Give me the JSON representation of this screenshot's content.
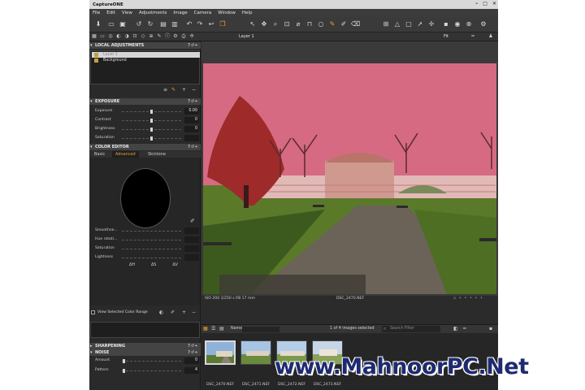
{
  "app": {
    "title": "CaptureONE",
    "window_controls": [
      "–",
      "□",
      "✕"
    ]
  },
  "menu": [
    "File",
    "Edit",
    "View",
    "Adjustments",
    "Image",
    "Camera",
    "Window",
    "Help"
  ],
  "toolbar2": {
    "layer_selector": "Layer 1",
    "fit_label": "Fit"
  },
  "local_adjustments": {
    "header": "LOCAL ADJUSTMENTS",
    "layers": [
      {
        "name": "Layer 1",
        "selected": true
      },
      {
        "name": "Background",
        "selected": false
      }
    ]
  },
  "exposure": {
    "header": "EXPOSURE",
    "sliders": [
      {
        "label": "Exposure",
        "value": "0.00",
        "position": 0.5
      },
      {
        "label": "Contrast",
        "value": "0",
        "position": 0.5
      },
      {
        "label": "Brightness",
        "value": "0",
        "position": 0.5
      },
      {
        "label": "Saturation",
        "value": "",
        "position": 0.5
      }
    ]
  },
  "color_editor": {
    "header": "COLOR EDITOR",
    "tabs": [
      "Basic",
      "Advanced",
      "Skintone"
    ],
    "active_tab": "Advanced",
    "sliders": [
      {
        "label": "Smoothne...",
        "value": ""
      },
      {
        "label": "Hue rotati...",
        "value": ""
      },
      {
        "label": "Saturation",
        "value": ""
      },
      {
        "label": "Lightness",
        "value": ""
      }
    ],
    "hsl_labels": [
      "ΔH",
      "ΔS",
      "ΔV"
    ],
    "view_range_label": "View Selected Color Range"
  },
  "sharpening": {
    "header": "SHARPENING"
  },
  "noise": {
    "header": "NOISE",
    "sliders": [
      {
        "label": "Amount",
        "value": "0",
        "position": 0.05
      },
      {
        "label": "Pattern",
        "value": "4",
        "position": 0.05
      }
    ]
  },
  "viewer": {
    "meta": "ISO 200  1/250 s  f/8  17 mm",
    "filename": "DSC_2470.NEF"
  },
  "browser": {
    "sort_label": "Name",
    "count": "1 of 4 images selected",
    "search_placeholder": "Search Filter"
  },
  "thumbnails": [
    {
      "label": "DSC_2470.NEF",
      "selected": true
    },
    {
      "label": "DSC_2471.NEF",
      "selected": false
    },
    {
      "label": "DSC_2472.NEF",
      "selected": false
    },
    {
      "label": "DSC_2473.NEF",
      "selected": false
    }
  ],
  "watermark": "www.MahnoorPC.Net",
  "colors": {
    "accent": "#e9a12b",
    "sky_tint": "#d66a82",
    "panel": "#2b2b2b"
  }
}
